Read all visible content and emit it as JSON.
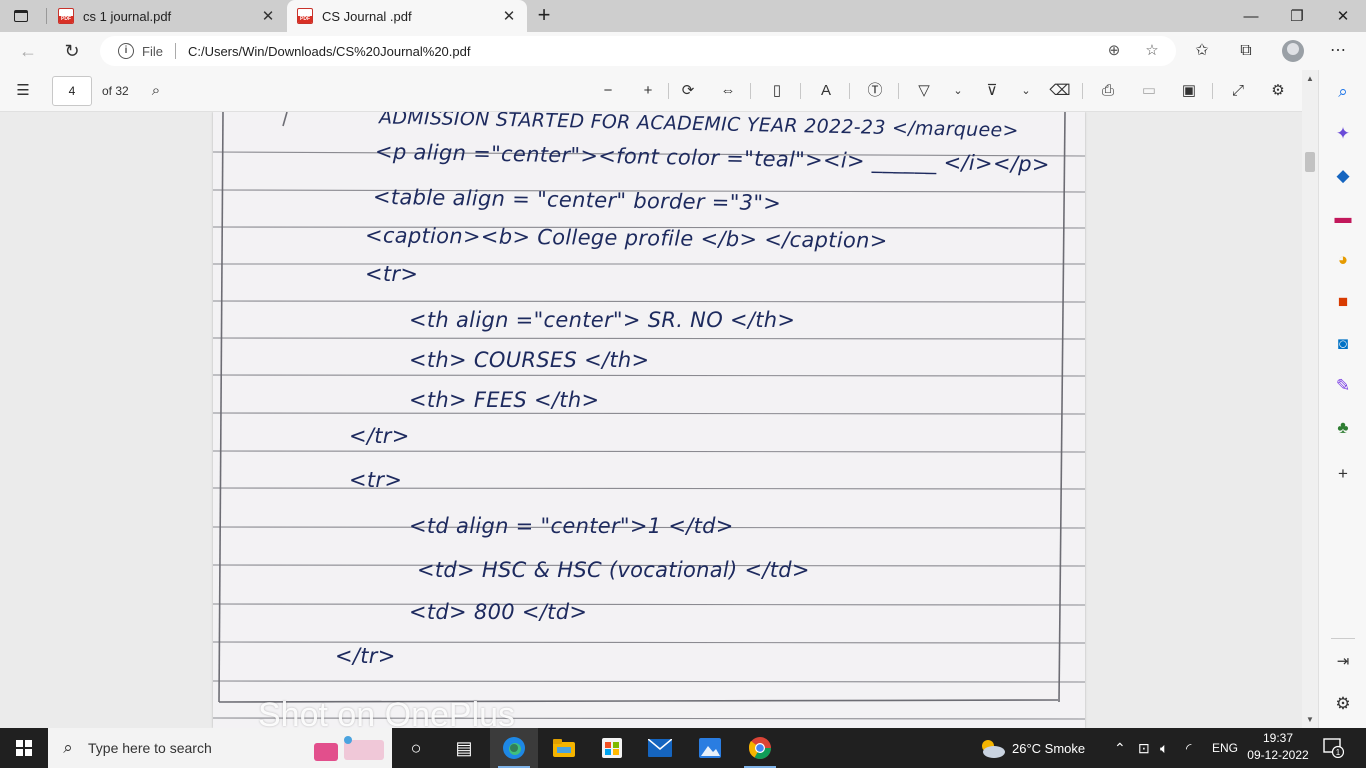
{
  "browser": {
    "tabs": [
      {
        "title": "cs 1 journal.pdf",
        "active": false
      },
      {
        "title": "CS Journal .pdf",
        "active": true
      }
    ],
    "address": {
      "scheme_label": "File",
      "url": "C:/Users/Win/Downloads/CS%20Journal%20.pdf"
    }
  },
  "pdf_toolbar": {
    "page_number": "4",
    "page_total": "of 32"
  },
  "document": {
    "lines": [
      "ADMISSION STARTED FOR ACADEMIC YEAR 2022-23 </marquee>",
      "<p align =\"center\"><font color =\"teal\"><i> ______ </i></p>",
      "<table align = \"center\" border =\"3\">",
      "<caption><b> College profile </b> </caption>",
      "<tr>",
      "<th align =\"center\"> SR. NO </th>",
      "<th> COURSES </th>",
      "<th> FEES </th>",
      "</tr>",
      "<tr>",
      "<td align = \"center\">1 </td>",
      "<td> HSC & HSC (vocational) </td>",
      "<td> 800 </td>",
      "</tr>"
    ],
    "watermark": "Shot on OnePlus"
  },
  "taskbar": {
    "search_placeholder": "Type here to search",
    "weather": "26°C  Smoke",
    "language": "ENG",
    "time": "19:37",
    "date": "09-12-2022"
  },
  "colors": {
    "ink": "#1d2a5e",
    "paper": "#f3f2f4",
    "taskbar": "#202020"
  }
}
